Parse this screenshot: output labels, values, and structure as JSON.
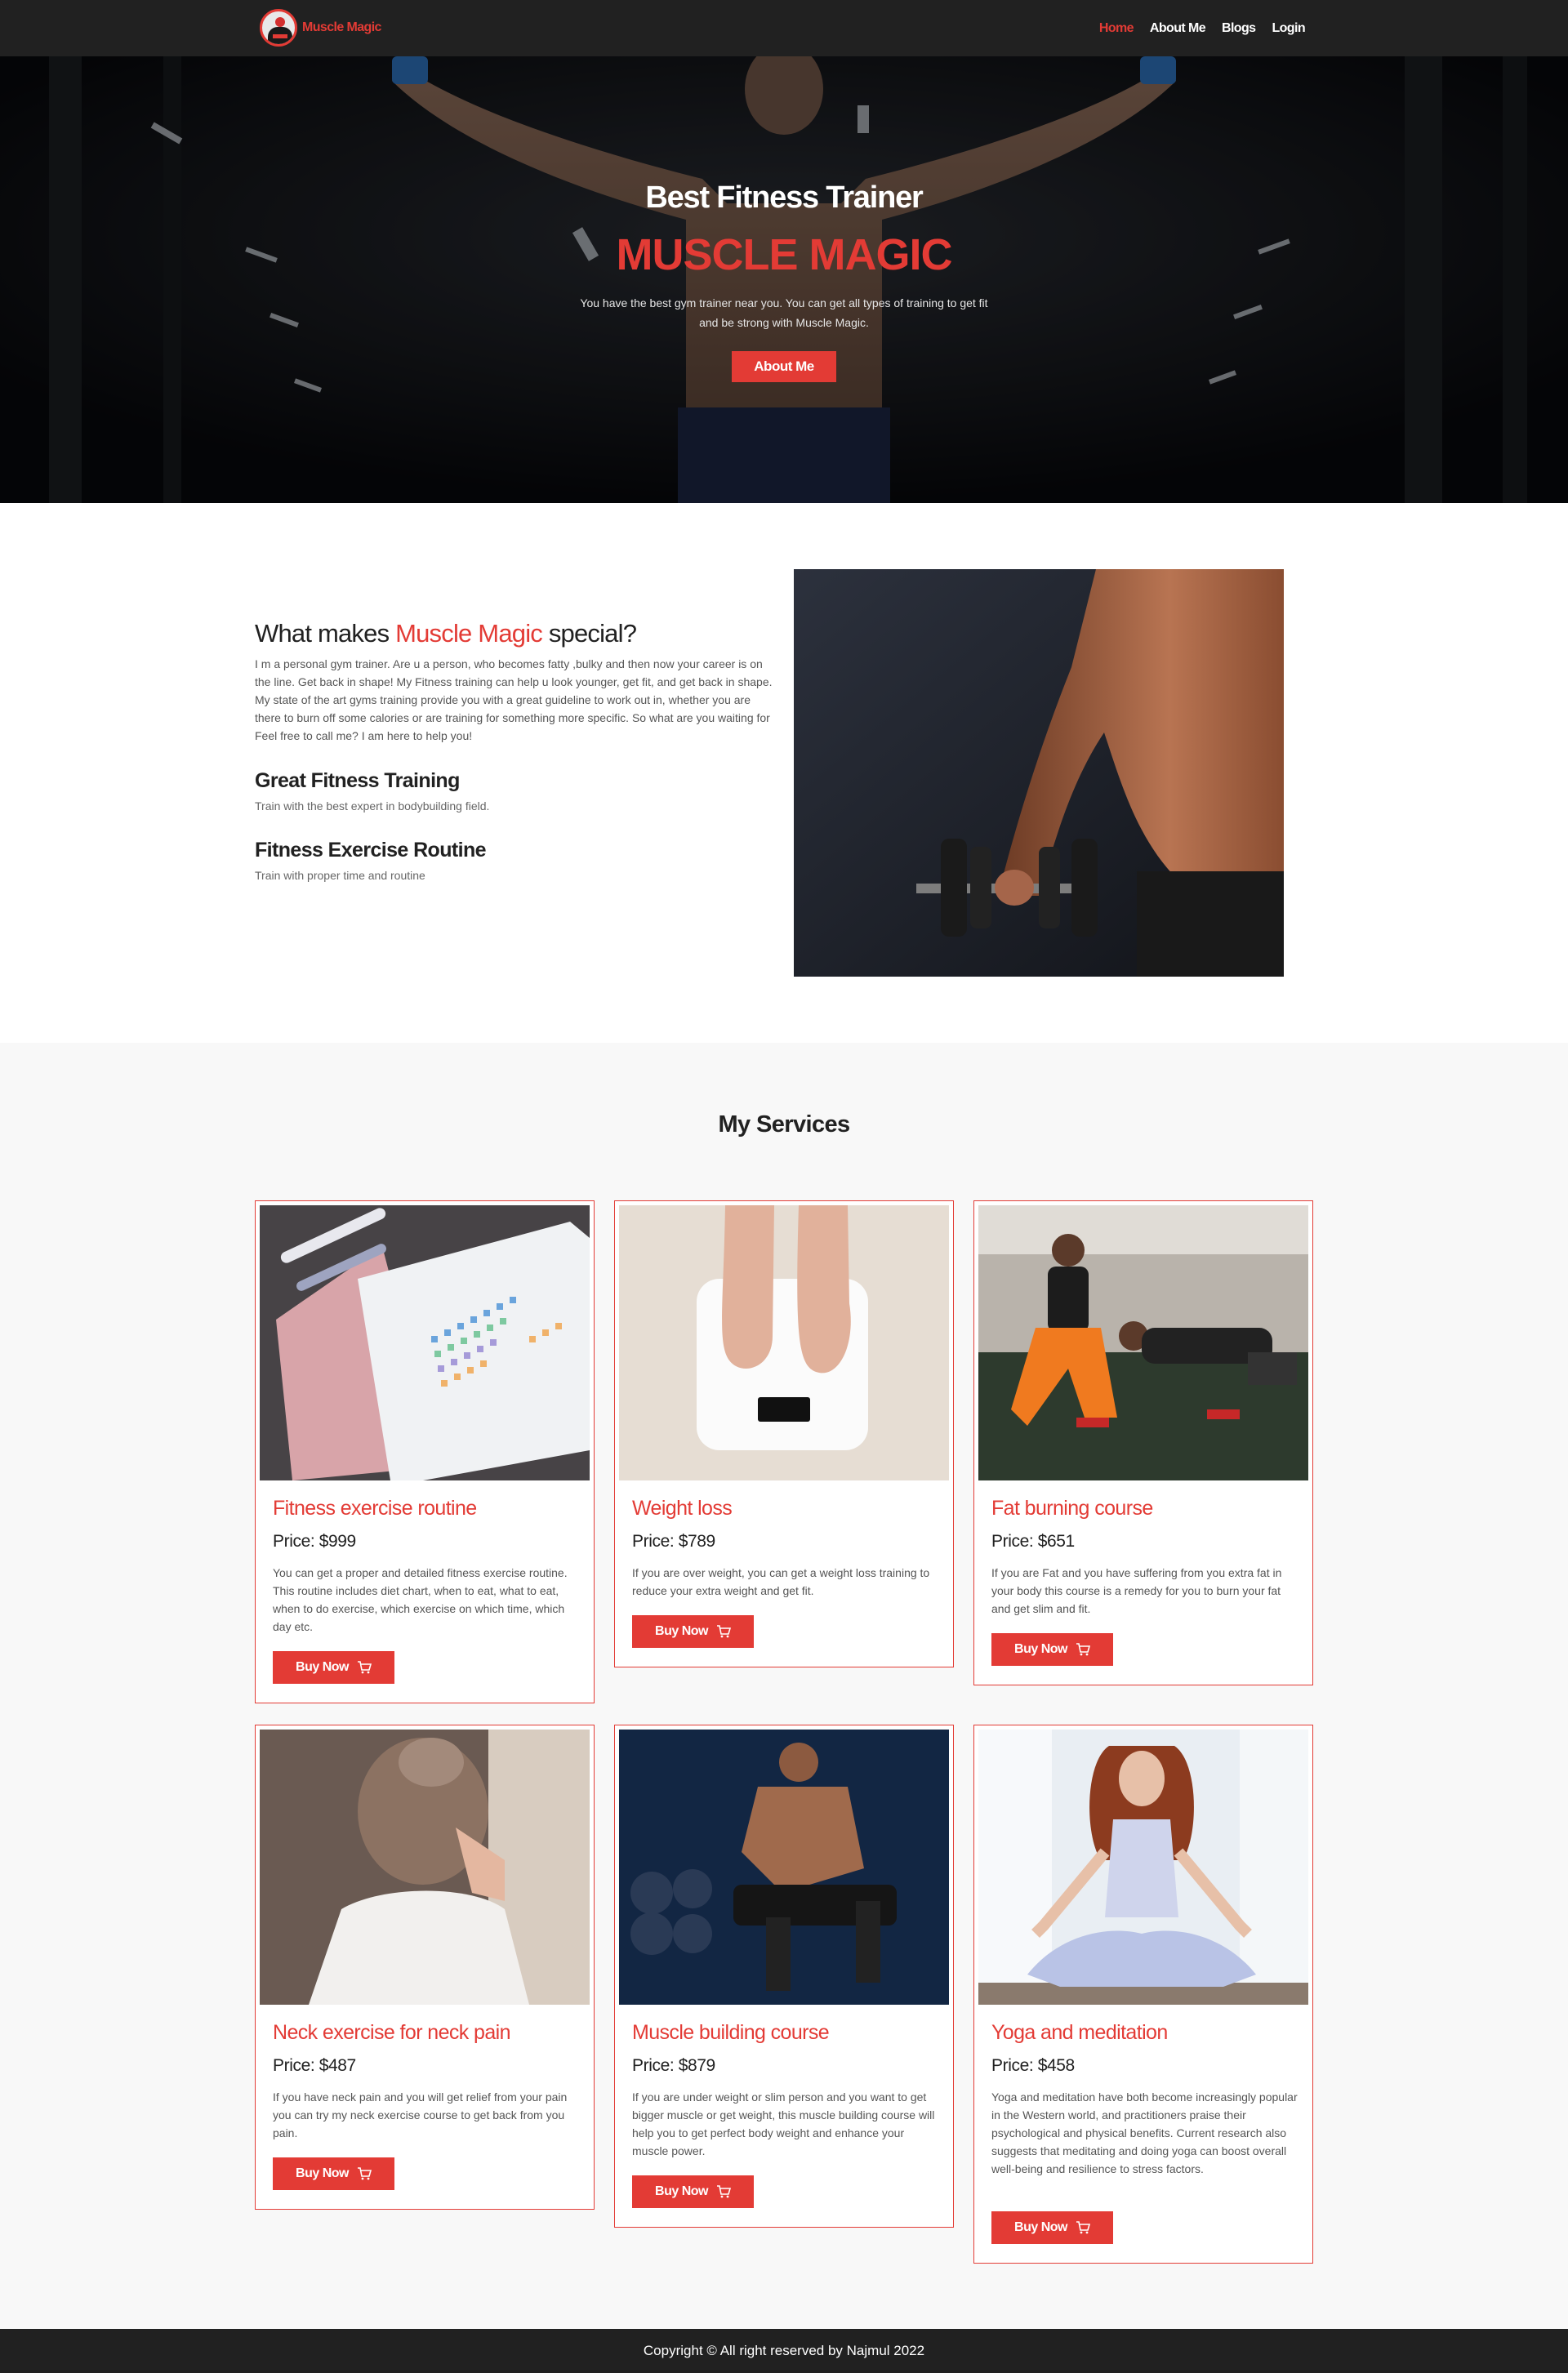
{
  "nav": {
    "brand": "Muscle Magic",
    "logo_icon": "bodybuilder-logo-icon",
    "items": [
      {
        "label": "Home",
        "active": true
      },
      {
        "label": "About Me",
        "active": false
      },
      {
        "label": "Blogs",
        "active": false
      },
      {
        "label": "Login",
        "active": false
      }
    ]
  },
  "hero": {
    "subtitle": "Best Fitness Trainer",
    "title": "MUSCLE MAGIC",
    "description": "You have the best gym trainer near you. You can get all types of training to get fit and be strong with Muscle Magic.",
    "button": "About Me"
  },
  "special": {
    "title_prefix": "What makes ",
    "title_highlight": "Muscle Magic",
    "title_suffix": " special?",
    "paragraph": "I m a personal gym trainer. Are u a person, who becomes fatty ,bulky and then now your career is on the line. Get back in shape! My Fitness training can help u look younger, get fit, and get back in shape. My state of the art gyms training provide you with a great guideline to work out in, whether you are there to burn off some calories or are training for something more specific. So what are you waiting for Feel free to call me? I am here to help you!",
    "features": [
      {
        "title": "Great Fitness Training",
        "text": "Train with the best expert in bodybuilding field."
      },
      {
        "title": "Fitness Exercise Routine",
        "text": "Train with proper time and routine"
      }
    ]
  },
  "services": {
    "heading": "My Services",
    "buy_label": "Buy Now",
    "cart_icon": "cart-icon",
    "items": [
      {
        "title": "Fitness exercise routine",
        "price": "Price: $999",
        "description": "You can get a proper and detailed fitness exercise routine. This routine includes diet chart, when to eat, what to eat, when to do exercise, which exercise on which time, which day etc."
      },
      {
        "title": "Weight loss",
        "price": "Price: $789",
        "description": "If you are over weight, you can get a weight loss training to reduce your extra weight and get fit."
      },
      {
        "title": "Fat burning course",
        "price": "Price: $651",
        "description": "If you are Fat and you have suffering from you extra fat in your body this course is a remedy for you to burn your fat and get slim and fit."
      },
      {
        "title": "Neck exercise for neck pain",
        "price": "Price: $487",
        "description": "If you have neck pain and you will get relief from your pain you can try my neck exercise course to get back from you pain."
      },
      {
        "title": "Muscle building course",
        "price": "Price: $879",
        "description": "If you are under weight or slim person and you want to get bigger muscle or get weight, this muscle building course will help you to get perfect body weight and enhance your muscle power."
      },
      {
        "title": "Yoga and meditation",
        "price": "Price: $458",
        "description": "Yoga and meditation have both become increasingly popular in the Western world, and practitioners praise their psychological and physical benefits. Current research also suggests that meditating and doing yoga can boost overall well-being and resilience to stress factors."
      }
    ]
  },
  "footer": {
    "copyright": "Copyright © All right reserved by Najmul 2022"
  },
  "colors": {
    "accent": "#e33b35",
    "dark": "#212121"
  }
}
